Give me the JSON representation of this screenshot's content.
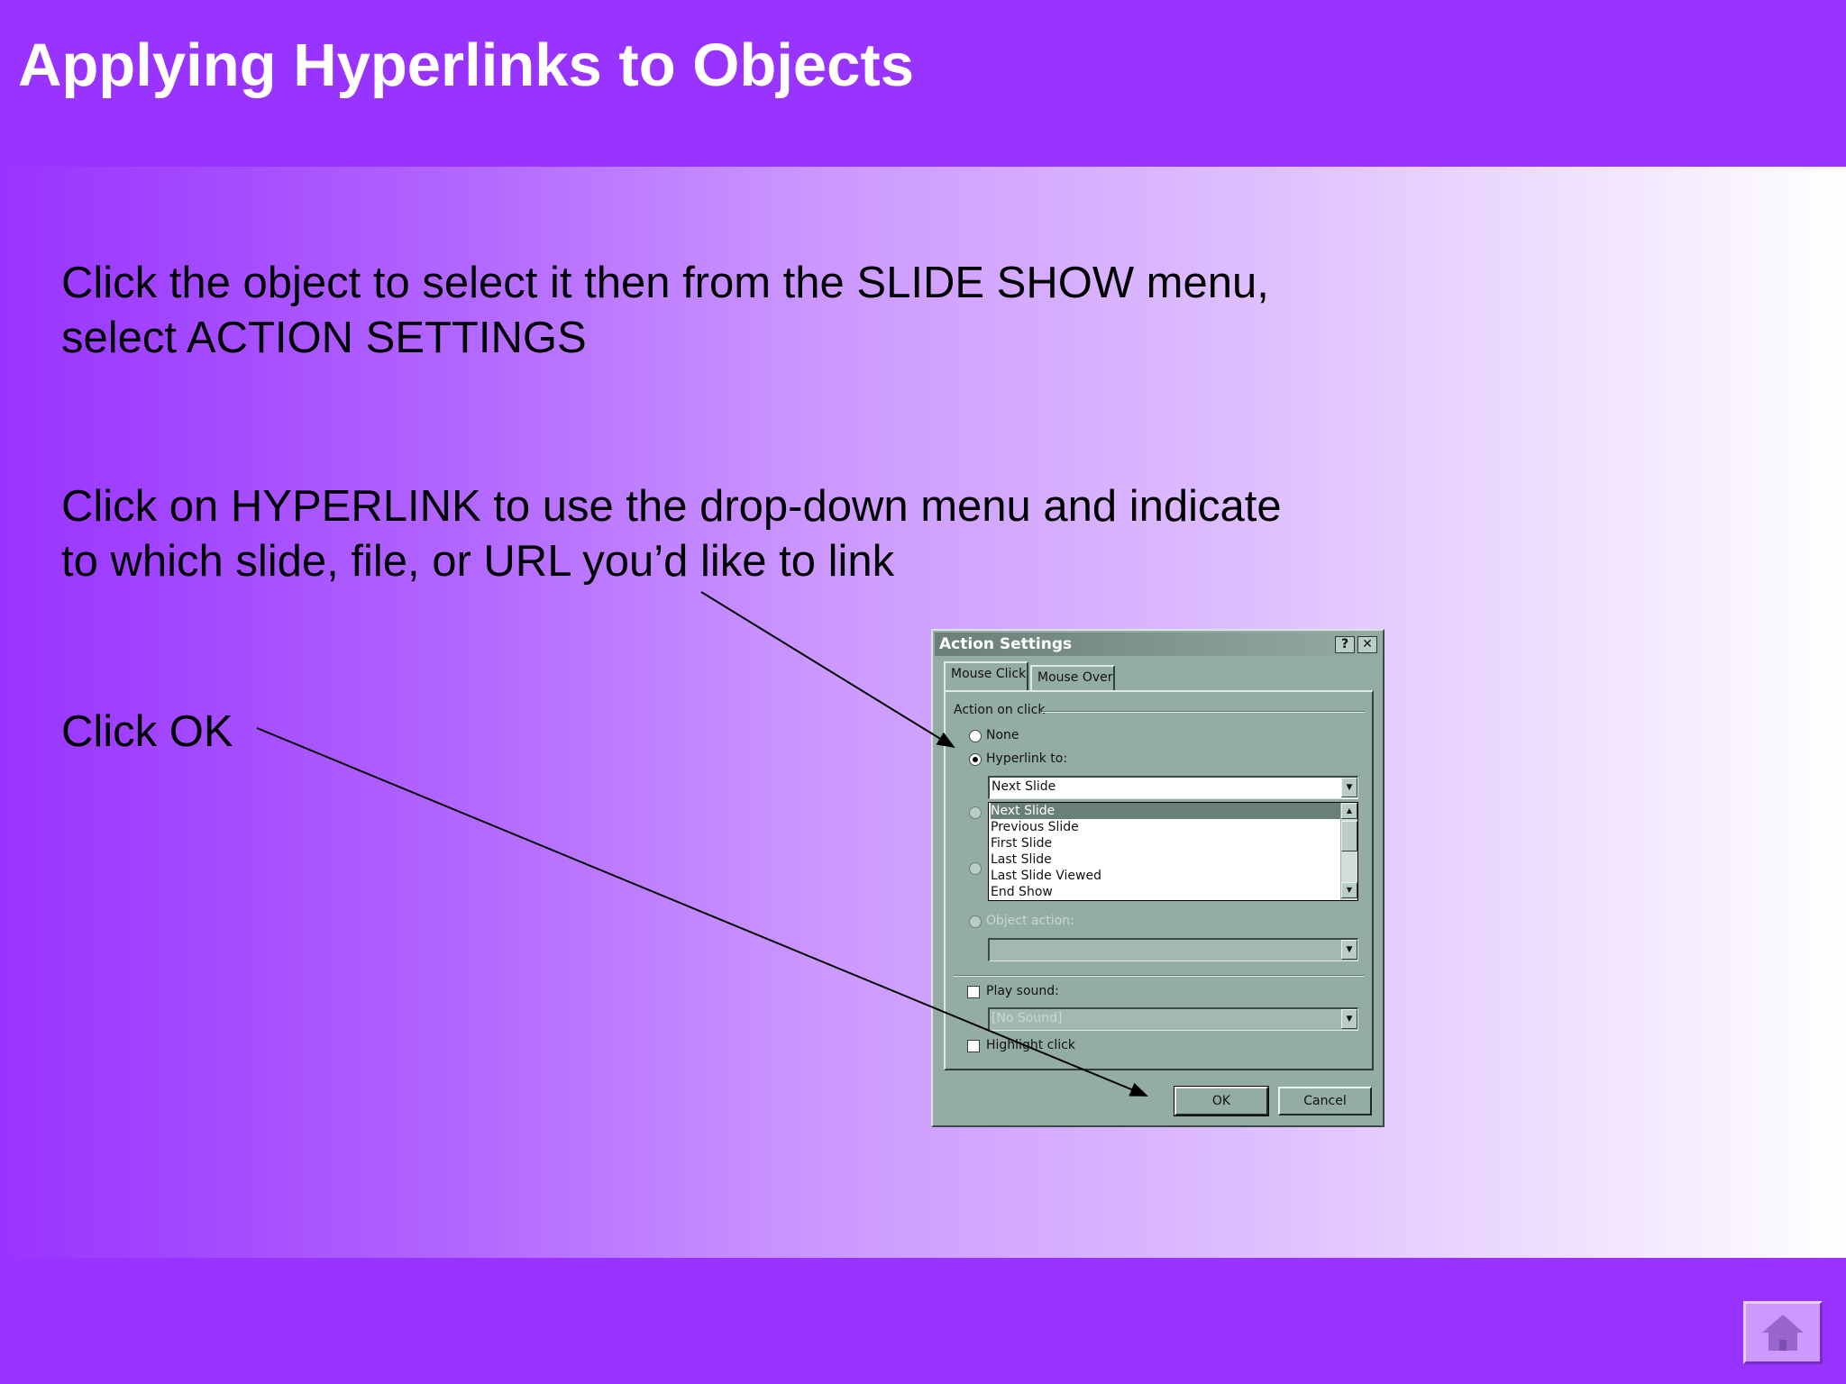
{
  "slide": {
    "title": "Applying Hyperlinks to Objects",
    "paragraph1_line1": "Click the object to select it then from the SLIDE SHOW menu,",
    "paragraph1_line2": "select ACTION SETTINGS",
    "paragraph2_line1": "Click on HYPERLINK to use the drop-down menu and indicate",
    "paragraph2_line2": "to which slide, file, or URL you’d like to link",
    "paragraph3": "Click OK",
    "home_icon": "home-icon"
  },
  "dialog": {
    "title": "Action Settings",
    "help_glyph": "?",
    "close_glyph": "✕",
    "tabs": [
      "Mouse Click",
      "Mouse Over"
    ],
    "group_label": "Action on click",
    "options": {
      "none": "None",
      "hyperlink": "Hyperlink to:",
      "object_action": "Object action:",
      "play_sound": "Play sound:",
      "highlight_click": "Highlight click"
    },
    "hyperlink_value": "Next Slide",
    "hyperlink_list": [
      "Next Slide",
      "Previous Slide",
      "First Slide",
      "Last Slide",
      "Last Slide Viewed",
      "End Show"
    ],
    "sound_value": "[No Sound]",
    "ok_label": "OK",
    "cancel_label": "Cancel",
    "colors": {
      "dialog_face": "#93ada4",
      "selection": "#6a7f78"
    }
  },
  "theme": {
    "header_color": "#9933ff",
    "gradient_end": "#ffffff"
  }
}
